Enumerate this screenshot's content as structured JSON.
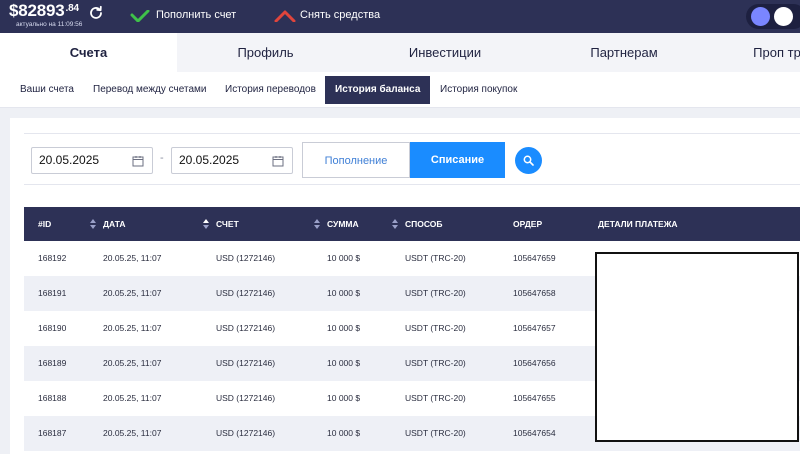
{
  "header": {
    "balance_main": "$82893",
    "balance_cents": ".84",
    "updated_text": "актуально на 11:09:56",
    "deposit_label": "Пополнить счет",
    "withdraw_label": "Снять средства",
    "deposit_icon": "check-icon",
    "withdraw_icon": "chevron-up-icon",
    "colors": {
      "bar": "#2d3156",
      "deposit": "#3fc14a",
      "withdraw": "#e0453c"
    }
  },
  "main_tabs": [
    {
      "label": "Счета",
      "active": true
    },
    {
      "label": "Профиль",
      "active": false
    },
    {
      "label": "Инвестиции",
      "active": false
    },
    {
      "label": "Партнерам",
      "active": false
    },
    {
      "label": "Проп тр",
      "active": false
    }
  ],
  "sub_tabs": [
    {
      "label": "Ваши счета",
      "active": false
    },
    {
      "label": "Перевод между счетами",
      "active": false
    },
    {
      "label": "История переводов",
      "active": false
    },
    {
      "label": "История баланса",
      "active": true
    },
    {
      "label": "История покупок",
      "active": false
    }
  ],
  "filters": {
    "date_from": "20.05.2025",
    "date_to": "20.05.2025",
    "separator": "-",
    "type_deposit": "Пополнение",
    "type_withdraw": "Списание",
    "selected_type": "Списание",
    "accent": "#1a8cff"
  },
  "table": {
    "columns": [
      "#ID",
      "ДАТА",
      "СЧЕТ",
      "СУММА",
      "СПОСОБ",
      "ОРДЕР",
      "ДЕТАЛИ ПЛАТЕЖА"
    ],
    "rows": [
      [
        "168192",
        "20.05.25, 11:07",
        "USD (1272146)",
        "10 000 $",
        "USDT (TRC-20)",
        "105647659",
        ""
      ],
      [
        "168191",
        "20.05.25, 11:07",
        "USD (1272146)",
        "10 000 $",
        "USDT (TRC-20)",
        "105647658",
        ""
      ],
      [
        "168190",
        "20.05.25, 11:07",
        "USD (1272146)",
        "10 000 $",
        "USDT (TRC-20)",
        "105647657",
        ""
      ],
      [
        "168189",
        "20.05.25, 11:07",
        "USD (1272146)",
        "10 000 $",
        "USDT (TRC-20)",
        "105647656",
        ""
      ],
      [
        "168188",
        "20.05.25, 11:07",
        "USD (1272146)",
        "10 000 $",
        "USDT (TRC-20)",
        "105647655",
        ""
      ],
      [
        "168187",
        "20.05.25, 11:07",
        "USD (1272146)",
        "10 000 $",
        "USDT (TRC-20)",
        "105647654",
        ""
      ]
    ]
  }
}
